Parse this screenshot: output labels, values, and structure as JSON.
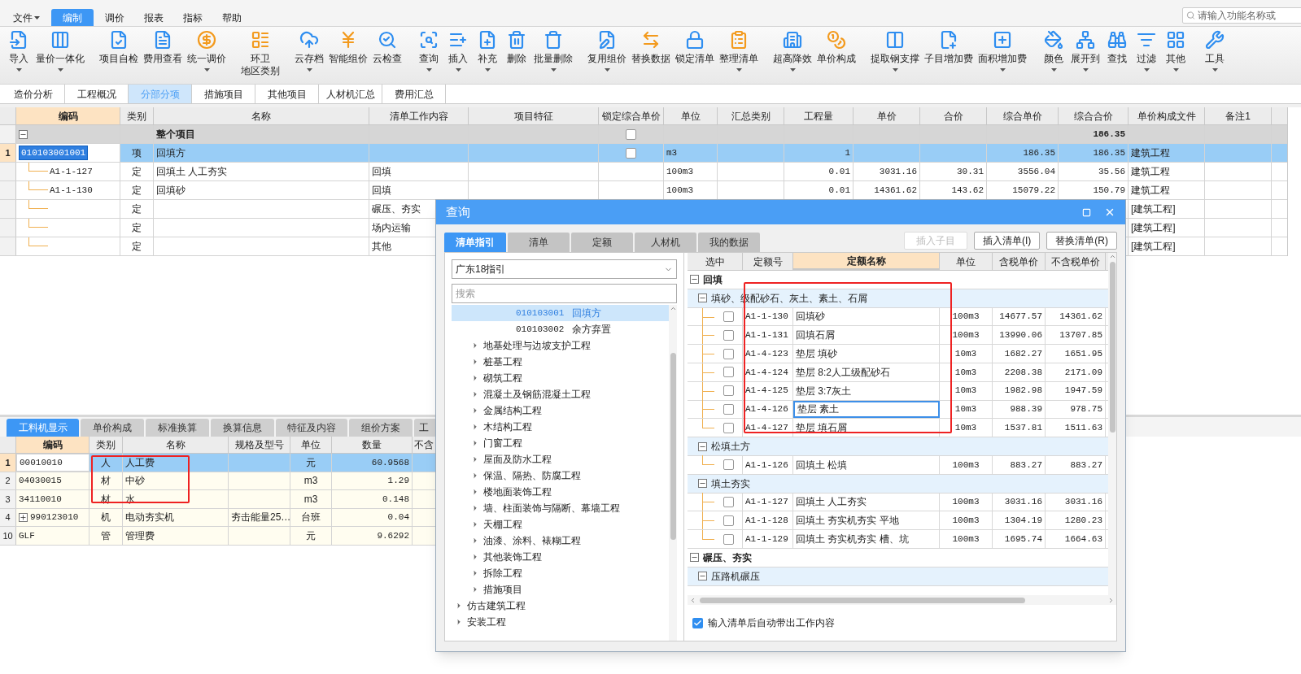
{
  "menu": {
    "items": [
      {
        "label": "文件",
        "dropdown": true,
        "selected": false
      },
      {
        "label": "编制",
        "dropdown": false,
        "selected": true
      },
      {
        "label": "调价",
        "dropdown": false,
        "selected": false
      },
      {
        "label": "报表",
        "dropdown": false,
        "selected": false
      },
      {
        "label": "指标",
        "dropdown": false,
        "selected": false
      },
      {
        "label": "帮助",
        "dropdown": false,
        "selected": false
      }
    ],
    "search": {
      "placeholder": "请输入功能名称或"
    }
  },
  "toolbar": {
    "groups": [
      [
        {
          "label": "导入",
          "dropdown": true
        },
        {
          "label": "量价一体化",
          "dropdown": true
        }
      ],
      [
        {
          "label": "项目自检",
          "dropdown": false
        },
        {
          "label": "费用查看",
          "dropdown": false
        },
        {
          "label": "统一调价",
          "dropdown": true
        }
      ],
      [
        {
          "label": "环卫",
          "label2": "地区类别",
          "dropdown": false
        }
      ],
      [
        {
          "label": "云存档",
          "dropdown": true
        },
        {
          "label": "智能组价",
          "dropdown": false
        },
        {
          "label": "云检查",
          "dropdown": false
        }
      ],
      [
        {
          "label": "查询",
          "dropdown": true
        },
        {
          "label": "插入",
          "dropdown": true
        },
        {
          "label": "补充",
          "dropdown": true
        },
        {
          "label": "删除",
          "dropdown": false
        },
        {
          "label": "批量删除",
          "dropdown": true
        }
      ],
      [
        {
          "label": "复用组价",
          "dropdown": true
        },
        {
          "label": "替换数据",
          "dropdown": false
        },
        {
          "label": "锁定清单",
          "dropdown": false
        },
        {
          "label": "整理清单",
          "dropdown": true
        }
      ],
      [
        {
          "label": "超高降效",
          "dropdown": true
        },
        {
          "label": "单价构成",
          "dropdown": false
        }
      ],
      [
        {
          "label": "提取钢支撑",
          "dropdown": true
        },
        {
          "label": "子目增加费",
          "dropdown": false
        },
        {
          "label": "面积增加费",
          "dropdown": true
        }
      ],
      [
        {
          "label": "颜色",
          "dropdown": true
        },
        {
          "label": "展开到",
          "dropdown": true
        },
        {
          "label": "查找",
          "dropdown": false
        },
        {
          "label": "过滤",
          "dropdown": true
        },
        {
          "label": "其他",
          "dropdown": true
        }
      ],
      [
        {
          "label": "工具",
          "dropdown": true
        }
      ]
    ]
  },
  "view_tabs": [
    {
      "label": "造价分析",
      "selected": false
    },
    {
      "label": "工程概况",
      "selected": false
    },
    {
      "label": "分部分项",
      "selected": true
    },
    {
      "label": "措施项目",
      "selected": false
    },
    {
      "label": "其他项目",
      "selected": false
    },
    {
      "label": "人材机汇总",
      "selected": false
    },
    {
      "label": "费用汇总",
      "selected": false
    }
  ],
  "main_table": {
    "columns": [
      "编码",
      "类别",
      "名称",
      "清单工作内容",
      "项目特征",
      "锁定综合单价",
      "单位",
      "汇总类别",
      "工程量",
      "单价",
      "合价",
      "综合单价",
      "综合合价",
      "单价构成文件",
      "备注1"
    ],
    "rows": [
      {
        "kind": "total",
        "selected": false,
        "name": "整个项目",
        "locked": false,
        "composite_total": "186.35"
      },
      {
        "kind": "item",
        "selected": true,
        "row_number": "1",
        "code": "010103001001",
        "type": "项",
        "name": "回填方",
        "locked": false,
        "unit": "m3",
        "quantity": "1",
        "composite_unit_price": "186.35",
        "composite_total": "186.35",
        "price_file": "建筑工程"
      },
      {
        "kind": "quota",
        "selected": false,
        "code": "A1-1-127",
        "type": "定",
        "name": "回填土 人工夯实",
        "work_content": "回填",
        "unit": "100m3",
        "quantity": "0.01",
        "unit_price": "3031.16",
        "total_price": "30.31",
        "composite_unit_price": "3556.04",
        "composite_total": "35.56",
        "price_file": "建筑工程"
      },
      {
        "kind": "quota",
        "selected": false,
        "code": "A1-1-130",
        "type": "定",
        "name": "回填砂",
        "work_content": "回填",
        "unit": "100m3",
        "quantity": "0.01",
        "unit_price": "14361.62",
        "total_price": "143.62",
        "composite_unit_price": "15079.22",
        "composite_total": "150.79",
        "price_file": "建筑工程"
      },
      {
        "kind": "quota",
        "selected": false,
        "type": "定",
        "work_content": "碾压、夯实",
        "price_file": "[建筑工程]"
      },
      {
        "kind": "quota",
        "selected": false,
        "type": "定",
        "work_content": "场内运输",
        "price_file": "[建筑工程]"
      },
      {
        "kind": "quota",
        "selected": false,
        "type": "定",
        "work_content": "其他",
        "price_file": "[建筑工程]"
      }
    ]
  },
  "bottom_tabs": [
    {
      "label": "工料机显示",
      "selected": true
    },
    {
      "label": "单价构成",
      "selected": false
    },
    {
      "label": "标准换算",
      "selected": false
    },
    {
      "label": "换算信息",
      "selected": false
    },
    {
      "label": "特征及内容",
      "selected": false
    },
    {
      "label": "组价方案",
      "selected": false
    },
    {
      "label": "工",
      "selected": false
    }
  ],
  "bottom_table": {
    "columns": [
      "编码",
      "类别",
      "名称",
      "规格及型号",
      "单位",
      "数量",
      "不含"
    ],
    "rows": [
      {
        "row_number": "1",
        "selected": true,
        "expandable": false,
        "code": "00010010",
        "type": "人",
        "name": "人工费",
        "unit": "元",
        "quantity": "60.9568"
      },
      {
        "row_number": "2",
        "selected": false,
        "expandable": false,
        "code": "04030015",
        "type": "材",
        "name": "中砂",
        "unit": "m3",
        "quantity": "1.29"
      },
      {
        "row_number": "3",
        "selected": false,
        "expandable": false,
        "code": "34110010",
        "type": "材",
        "name": "水",
        "unit": "m3",
        "quantity": "0.148"
      },
      {
        "row_number": "4",
        "selected": false,
        "expandable": true,
        "code": "990123010",
        "type": "机",
        "name": "电动夯实机",
        "spec": "夯击能量25…",
        "unit": "台班",
        "quantity": "0.04"
      },
      {
        "row_number": "10",
        "selected": false,
        "expandable": false,
        "code": "GLF",
        "type": "管",
        "name": "管理费",
        "unit": "元",
        "quantity": "9.6292"
      }
    ]
  },
  "dialog": {
    "title": "查询",
    "tabs": [
      {
        "label": "清单指引",
        "selected": true
      },
      {
        "label": "清单",
        "selected": false
      },
      {
        "label": "定额",
        "selected": false
      },
      {
        "label": "人材机",
        "selected": false
      },
      {
        "label": "我的数据",
        "selected": false
      }
    ],
    "buttons": [
      {
        "label": "插入子目",
        "disabled": true
      },
      {
        "label": "插入清单(I)",
        "disabled": false
      },
      {
        "label": "替换清单(R)",
        "disabled": false
      }
    ],
    "guide_select": {
      "value": "广东18指引"
    },
    "search": {
      "placeholder": "搜索"
    },
    "tree": [
      {
        "children": [
          {
            "children": [
              {
                "children": [
                  {
                    "code": "010103001",
                    "label": "回填方",
                    "selected": true
                  },
                  {
                    "code": "010103002",
                    "label": "余方弃置",
                    "selected": false
                  }
                ]
              }
            ]
          },
          {
            "label": "地基处理与边坡支护工程",
            "selected": false,
            "expanded": false
          },
          {
            "label": "桩基工程",
            "selected": false,
            "expanded": false
          },
          {
            "label": "砌筑工程",
            "selected": false,
            "expanded": false
          },
          {
            "label": "混凝土及钢筋混凝土工程",
            "selected": false,
            "expanded": false
          },
          {
            "label": "金属结构工程",
            "selected": false,
            "expanded": false
          },
          {
            "label": "木结构工程",
            "selected": false,
            "expanded": false
          },
          {
            "label": "门窗工程",
            "selected": false,
            "expanded": false
          },
          {
            "label": "屋面及防水工程",
            "selected": false,
            "expanded": false
          },
          {
            "label": "保温、隔热、防腐工程",
            "selected": false,
            "expanded": false
          },
          {
            "label": "楼地面装饰工程",
            "selected": false,
            "expanded": false
          },
          {
            "label": "墙、柱面装饰与隔断、幕墙工程",
            "selected": false,
            "expanded": false
          },
          {
            "label": "天棚工程",
            "selected": false,
            "expanded": false
          },
          {
            "label": "油漆、涂料、裱糊工程",
            "selected": false,
            "expanded": false
          },
          {
            "label": "其他装饰工程",
            "selected": false,
            "expanded": false
          },
          {
            "label": "拆除工程",
            "selected": false,
            "expanded": false
          },
          {
            "label": "措施项目",
            "selected": false,
            "expanded": false
          }
        ]
      },
      {
        "label": "仿古建筑工程",
        "selected": false,
        "expanded": false
      },
      {
        "label": "安装工程",
        "selected": false,
        "expanded": false
      }
    ],
    "grid": {
      "columns": [
        "选中",
        "定额号",
        "定额名称",
        "单位",
        "含税单价",
        "不含税单价"
      ],
      "groups": [
        {
          "label": "回填",
          "expanded": true,
          "children": [
            {
              "label": "填砂、级配砂石、灰土、素土、石屑",
              "expanded": true,
              "items": [
                {
                  "checked": false,
                  "focused": false,
                  "code": "A1-1-130",
                  "name": "回填砂",
                  "unit": "100m3",
                  "tax_price": "14677.57",
                  "price": "14361.62"
                },
                {
                  "checked": false,
                  "focused": false,
                  "code": "A1-1-131",
                  "name": "回填石屑",
                  "unit": "100m3",
                  "tax_price": "13990.06",
                  "price": "13707.85"
                },
                {
                  "checked": false,
                  "focused": false,
                  "code": "A1-4-123",
                  "name": "垫层 填砂",
                  "unit": "10m3",
                  "tax_price": "1682.27",
                  "price": "1651.95"
                },
                {
                  "checked": false,
                  "focused": false,
                  "code": "A1-4-124",
                  "name": "垫层 8:2人工级配砂石",
                  "unit": "10m3",
                  "tax_price": "2208.38",
                  "price": "2171.09"
                },
                {
                  "checked": false,
                  "focused": false,
                  "code": "A1-4-125",
                  "name": "垫层 3:7灰土",
                  "unit": "10m3",
                  "tax_price": "1982.98",
                  "price": "1947.59"
                },
                {
                  "checked": false,
                  "focused": true,
                  "code": "A1-4-126",
                  "name": "垫层 素土",
                  "unit": "10m3",
                  "tax_price": "988.39",
                  "price": "978.75"
                },
                {
                  "checked": false,
                  "focused": false,
                  "code": "A1-4-127",
                  "name": "垫层 填石屑",
                  "unit": "10m3",
                  "tax_price": "1537.81",
                  "price": "1511.63"
                }
              ]
            },
            {
              "label": "松填土方",
              "expanded": true,
              "items": [
                {
                  "checked": false,
                  "focused": false,
                  "code": "A1-1-126",
                  "name": "回填土 松填",
                  "unit": "100m3",
                  "tax_price": "883.27",
                  "price": "883.27"
                }
              ]
            },
            {
              "label": "填土夯实",
              "expanded": true,
              "items": [
                {
                  "checked": false,
                  "focused": false,
                  "code": "A1-1-127",
                  "name": "回填土 人工夯实",
                  "unit": "100m3",
                  "tax_price": "3031.16",
                  "price": "3031.16"
                },
                {
                  "checked": false,
                  "focused": false,
                  "code": "A1-1-128",
                  "name": "回填土 夯实机夯实 平地",
                  "unit": "100m3",
                  "tax_price": "1304.19",
                  "price": "1280.23"
                },
                {
                  "checked": false,
                  "focused": false,
                  "code": "A1-1-129",
                  "name": "回填土 夯实机夯实 槽、坑",
                  "unit": "100m3",
                  "tax_price": "1695.74",
                  "price": "1664.63"
                }
              ]
            }
          ]
        },
        {
          "label": "碾压、夯实",
          "expanded": true,
          "children": [
            {
              "label": "压路机碾压",
              "expanded": true
            }
          ]
        }
      ]
    },
    "auto_content": {
      "label": "输入清单后自动带出工作内容",
      "checked": true
    }
  }
}
